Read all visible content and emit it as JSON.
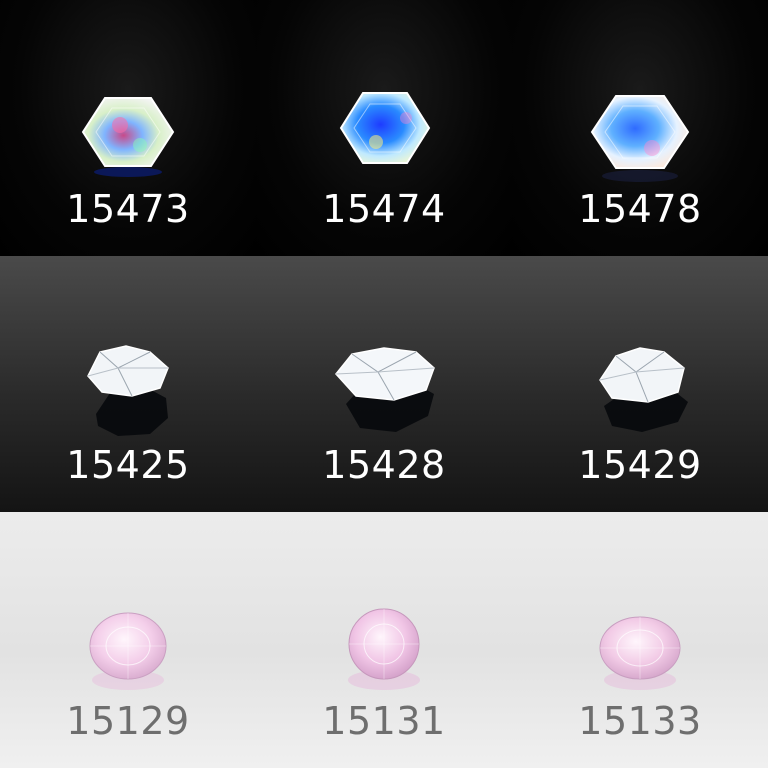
{
  "grid": {
    "items": [
      {
        "label": "15473",
        "gem": "opal-hexagon-icon"
      },
      {
        "label": "15474",
        "gem": "opal-hexagon-icon"
      },
      {
        "label": "15478",
        "gem": "opal-hexagon-icon"
      },
      {
        "label": "15425",
        "gem": "clear-quartz-crystal-icon"
      },
      {
        "label": "15428",
        "gem": "clear-quartz-crystal-icon"
      },
      {
        "label": "15429",
        "gem": "clear-quartz-crystal-icon"
      },
      {
        "label": "15129",
        "gem": "pink-oval-gem-icon"
      },
      {
        "label": "15131",
        "gem": "pink-round-gem-icon"
      },
      {
        "label": "15133",
        "gem": "pink-oval-gem-icon"
      }
    ]
  },
  "colors": {
    "dark_background": "#000000",
    "mid_background": "#2a2a2a",
    "light_background": "#e6e6e6",
    "opal": "#4f8fff",
    "quartz": "#e8edf2",
    "pink_gem": "#f0c8e6",
    "label_light": "#ffffff",
    "label_dark": "#6e6e6e"
  }
}
